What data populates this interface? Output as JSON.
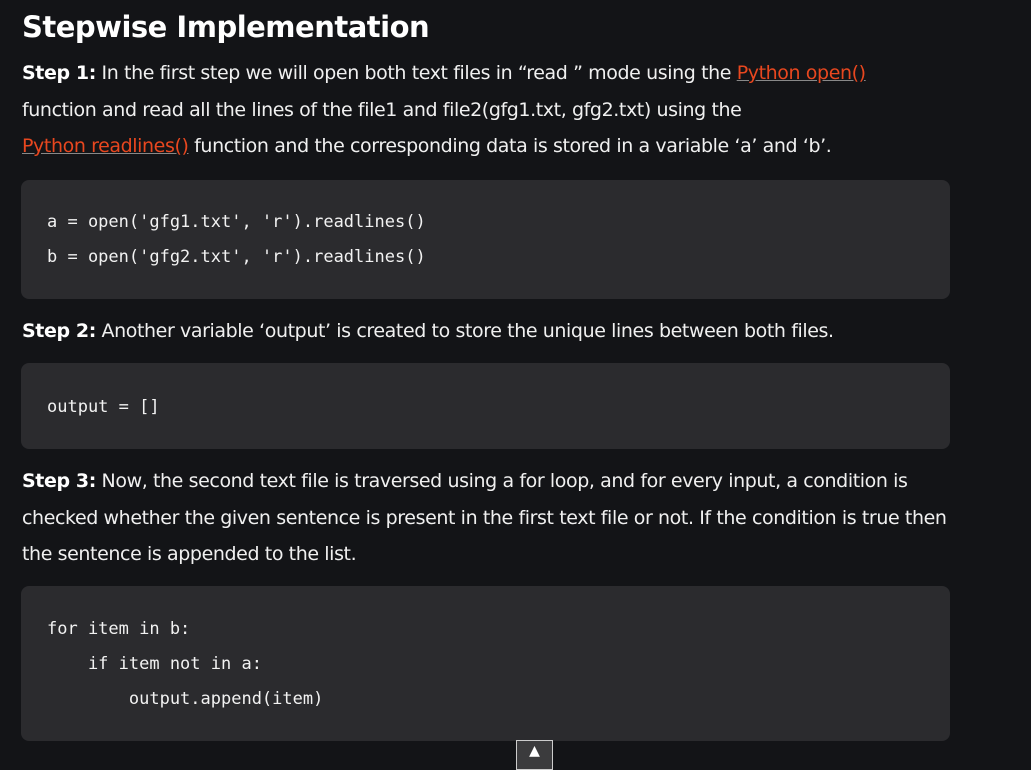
{
  "title": "Stepwise Implementation",
  "step1": {
    "label": "Step 1:",
    "text1": " In the first step we will open both text files in “read ” mode using the ",
    "link1": "Python open()",
    "text2": "function and read all the lines of the file1 and file2(gfg1.txt, gfg2.txt) using the",
    "link2": "Python readlines()",
    "text3": " function and the corresponding data is stored in a variable ‘a’ and ‘b’.",
    "code": [
      "a = open('gfg1.txt', 'r').readlines()",
      "b = open('gfg2.txt', 'r').readlines()"
    ]
  },
  "step2": {
    "label": "Step 2:",
    "text": " Another variable ‘output’ is created to store the unique lines between both files.",
    "code": [
      "output = []"
    ]
  },
  "step3": {
    "label": "Step 3:",
    "text": " Now, the second text file is traversed using a for loop, and for every input, a condition is checked whether the given sentence is present in the first text file or not. If the condition is true then the sentence is appended to the list.",
    "code": [
      "for item in b:",
      "    if item not in a:",
      "        output.append(item)"
    ]
  },
  "scroll_top_icon": "arrow-up-icon"
}
